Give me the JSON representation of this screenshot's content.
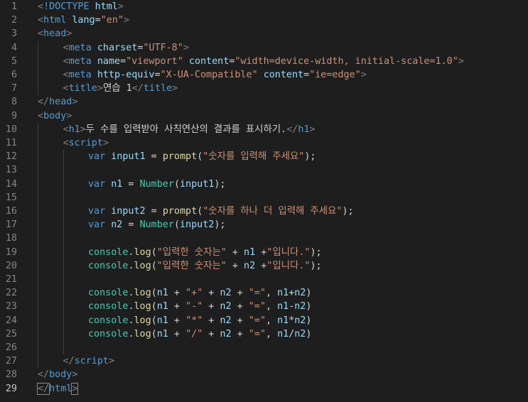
{
  "editor": {
    "active_line": 29,
    "lines": [
      {
        "n": "1",
        "indent": 0,
        "tokens": [
          [
            "g",
            "<"
          ],
          [
            "k",
            "!DOCTYPE"
          ],
          [
            "t",
            " "
          ],
          [
            "a",
            "html"
          ],
          [
            "g",
            ">"
          ]
        ]
      },
      {
        "n": "2",
        "indent": 0,
        "tokens": [
          [
            "g",
            "<"
          ],
          [
            "k",
            "html"
          ],
          [
            "t",
            " "
          ],
          [
            "a",
            "lang"
          ],
          [
            "t",
            "="
          ],
          [
            "s",
            "\"en\""
          ],
          [
            "g",
            ">"
          ]
        ]
      },
      {
        "n": "3",
        "indent": 0,
        "tokens": [
          [
            "g",
            "<"
          ],
          [
            "k",
            "head"
          ],
          [
            "g",
            ">"
          ]
        ]
      },
      {
        "n": "4",
        "indent": 1,
        "tokens": [
          [
            "g",
            "<"
          ],
          [
            "k",
            "meta"
          ],
          [
            "t",
            " "
          ],
          [
            "a",
            "charset"
          ],
          [
            "t",
            "="
          ],
          [
            "s",
            "\"UTF-8\""
          ],
          [
            "g",
            ">"
          ]
        ]
      },
      {
        "n": "5",
        "indent": 1,
        "tokens": [
          [
            "g",
            "<"
          ],
          [
            "k",
            "meta"
          ],
          [
            "t",
            " "
          ],
          [
            "a",
            "name"
          ],
          [
            "t",
            "="
          ],
          [
            "s",
            "\"viewport\""
          ],
          [
            "t",
            " "
          ],
          [
            "a",
            "content"
          ],
          [
            "t",
            "="
          ],
          [
            "s",
            "\"width=device-width, initial-scale=1.0\""
          ],
          [
            "g",
            ">"
          ]
        ]
      },
      {
        "n": "6",
        "indent": 1,
        "tokens": [
          [
            "g",
            "<"
          ],
          [
            "k",
            "meta"
          ],
          [
            "t",
            " "
          ],
          [
            "a",
            "http-equiv"
          ],
          [
            "t",
            "="
          ],
          [
            "s",
            "\"X-UA-Compatible\""
          ],
          [
            "t",
            " "
          ],
          [
            "a",
            "content"
          ],
          [
            "t",
            "="
          ],
          [
            "s",
            "\"ie=edge\""
          ],
          [
            "g",
            ">"
          ]
        ]
      },
      {
        "n": "7",
        "indent": 1,
        "tokens": [
          [
            "g",
            "<"
          ],
          [
            "k",
            "title"
          ],
          [
            "g",
            ">"
          ],
          [
            "t",
            "연습 1"
          ],
          [
            "g",
            "</"
          ],
          [
            "k",
            "title"
          ],
          [
            "g",
            ">"
          ]
        ]
      },
      {
        "n": "8",
        "indent": 0,
        "tokens": [
          [
            "g",
            "</"
          ],
          [
            "k",
            "head"
          ],
          [
            "g",
            ">"
          ]
        ]
      },
      {
        "n": "9",
        "indent": 0,
        "tokens": [
          [
            "g",
            "<"
          ],
          [
            "k",
            "body"
          ],
          [
            "g",
            ">"
          ]
        ]
      },
      {
        "n": "10",
        "indent": 1,
        "tokens": [
          [
            "g",
            "<"
          ],
          [
            "k",
            "h1"
          ],
          [
            "g",
            ">"
          ],
          [
            "t",
            "두 수를 입력받아 사칙연산의 결과를 표시하기."
          ],
          [
            "g",
            "</"
          ],
          [
            "k",
            "h1"
          ],
          [
            "g",
            ">"
          ]
        ]
      },
      {
        "n": "11",
        "indent": 1,
        "tokens": [
          [
            "g",
            "<"
          ],
          [
            "k",
            "script"
          ],
          [
            "g",
            ">"
          ]
        ]
      },
      {
        "n": "12",
        "indent": 2,
        "tokens": [
          [
            "k",
            "var"
          ],
          [
            "t",
            " "
          ],
          [
            "a",
            "input1"
          ],
          [
            "t",
            " = "
          ],
          [
            "f",
            "prompt"
          ],
          [
            "t",
            "("
          ],
          [
            "s",
            "\"숫자를 입력해 주세요\""
          ],
          [
            "t",
            ");"
          ]
        ]
      },
      {
        "n": "13",
        "indent": 2,
        "tokens": []
      },
      {
        "n": "14",
        "indent": 2,
        "tokens": [
          [
            "k",
            "var"
          ],
          [
            "t",
            " "
          ],
          [
            "a",
            "n1"
          ],
          [
            "t",
            " = "
          ],
          [
            "c",
            "Number"
          ],
          [
            "t",
            "("
          ],
          [
            "a",
            "input1"
          ],
          [
            "t",
            ");"
          ]
        ]
      },
      {
        "n": "15",
        "indent": 2,
        "tokens": []
      },
      {
        "n": "16",
        "indent": 2,
        "tokens": [
          [
            "k",
            "var"
          ],
          [
            "t",
            " "
          ],
          [
            "a",
            "input2"
          ],
          [
            "t",
            " = "
          ],
          [
            "f",
            "prompt"
          ],
          [
            "t",
            "("
          ],
          [
            "s",
            "\"숫자를 하나 더 입력해 주세요\""
          ],
          [
            "t",
            ");"
          ]
        ]
      },
      {
        "n": "17",
        "indent": 2,
        "tokens": [
          [
            "k",
            "var"
          ],
          [
            "t",
            " "
          ],
          [
            "a",
            "n2"
          ],
          [
            "t",
            " = "
          ],
          [
            "c",
            "Number"
          ],
          [
            "t",
            "("
          ],
          [
            "a",
            "input2"
          ],
          [
            "t",
            ");"
          ]
        ]
      },
      {
        "n": "18",
        "indent": 2,
        "tokens": []
      },
      {
        "n": "19",
        "indent": 2,
        "tokens": [
          [
            "c",
            "console"
          ],
          [
            "t",
            "."
          ],
          [
            "f",
            "log"
          ],
          [
            "t",
            "("
          ],
          [
            "s",
            "\"입력한 숫자는\""
          ],
          [
            "t",
            " + "
          ],
          [
            "a",
            "n1"
          ],
          [
            "t",
            " +"
          ],
          [
            "s",
            "\"입니다.\""
          ],
          [
            "t",
            ");"
          ]
        ]
      },
      {
        "n": "20",
        "indent": 2,
        "tokens": [
          [
            "c",
            "console"
          ],
          [
            "t",
            "."
          ],
          [
            "f",
            "log"
          ],
          [
            "t",
            "("
          ],
          [
            "s",
            "\"입력한 숫자는\""
          ],
          [
            "t",
            " + "
          ],
          [
            "a",
            "n2"
          ],
          [
            "t",
            " +"
          ],
          [
            "s",
            "\"입니다.\""
          ],
          [
            "t",
            ");"
          ]
        ]
      },
      {
        "n": "21",
        "indent": 2,
        "tokens": []
      },
      {
        "n": "22",
        "indent": 2,
        "tokens": [
          [
            "c",
            "console"
          ],
          [
            "t",
            "."
          ],
          [
            "f",
            "log"
          ],
          [
            "t",
            "("
          ],
          [
            "a",
            "n1"
          ],
          [
            "t",
            " + "
          ],
          [
            "s",
            "\"+\""
          ],
          [
            "t",
            " + "
          ],
          [
            "a",
            "n2"
          ],
          [
            "t",
            " + "
          ],
          [
            "s",
            "\"=\""
          ],
          [
            "t",
            ", "
          ],
          [
            "a",
            "n1"
          ],
          [
            "t",
            "+"
          ],
          [
            "a",
            "n2"
          ],
          [
            "t",
            ")"
          ]
        ]
      },
      {
        "n": "23",
        "indent": 2,
        "tokens": [
          [
            "c",
            "console"
          ],
          [
            "t",
            "."
          ],
          [
            "f",
            "log"
          ],
          [
            "t",
            "("
          ],
          [
            "a",
            "n1"
          ],
          [
            "t",
            " + "
          ],
          [
            "s",
            "\"-\""
          ],
          [
            "t",
            " + "
          ],
          [
            "a",
            "n2"
          ],
          [
            "t",
            " + "
          ],
          [
            "s",
            "\"=\""
          ],
          [
            "t",
            ", "
          ],
          [
            "a",
            "n1"
          ],
          [
            "t",
            "-"
          ],
          [
            "a",
            "n2"
          ],
          [
            "t",
            ")"
          ]
        ]
      },
      {
        "n": "24",
        "indent": 2,
        "tokens": [
          [
            "c",
            "console"
          ],
          [
            "t",
            "."
          ],
          [
            "f",
            "log"
          ],
          [
            "t",
            "("
          ],
          [
            "a",
            "n1"
          ],
          [
            "t",
            " + "
          ],
          [
            "s",
            "\"*\""
          ],
          [
            "t",
            " + "
          ],
          [
            "a",
            "n2"
          ],
          [
            "t",
            " + "
          ],
          [
            "s",
            "\"=\""
          ],
          [
            "t",
            ", "
          ],
          [
            "a",
            "n1"
          ],
          [
            "t",
            "*"
          ],
          [
            "a",
            "n2"
          ],
          [
            "t",
            ")"
          ]
        ]
      },
      {
        "n": "25",
        "indent": 2,
        "tokens": [
          [
            "c",
            "console"
          ],
          [
            "t",
            "."
          ],
          [
            "f",
            "log"
          ],
          [
            "t",
            "("
          ],
          [
            "a",
            "n1"
          ],
          [
            "t",
            " + "
          ],
          [
            "s",
            "\"/\""
          ],
          [
            "t",
            " + "
          ],
          [
            "a",
            "n2"
          ],
          [
            "t",
            " + "
          ],
          [
            "s",
            "\"=\""
          ],
          [
            "t",
            ", "
          ],
          [
            "a",
            "n1"
          ],
          [
            "t",
            "/"
          ],
          [
            "a",
            "n2"
          ],
          [
            "t",
            ")"
          ]
        ]
      },
      {
        "n": "26",
        "indent": 2,
        "tokens": []
      },
      {
        "n": "27",
        "indent": 1,
        "tokens": [
          [
            "g",
            "</"
          ],
          [
            "k",
            "script"
          ],
          [
            "g",
            ">"
          ]
        ]
      },
      {
        "n": "28",
        "indent": 0,
        "tokens": [
          [
            "g",
            "</"
          ],
          [
            "k",
            "body"
          ],
          [
            "g",
            ">"
          ]
        ]
      },
      {
        "n": "29",
        "indent": 0,
        "tokens": [
          [
            "g",
            "</"
          ],
          [
            "k",
            "html"
          ],
          [
            "g",
            ">"
          ]
        ]
      }
    ]
  }
}
